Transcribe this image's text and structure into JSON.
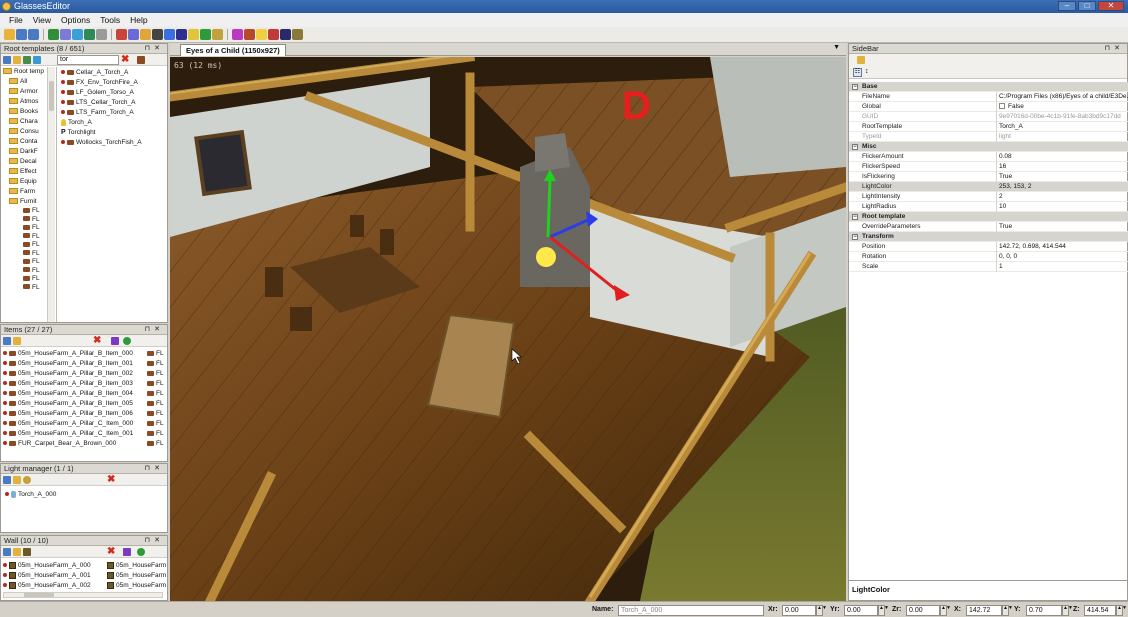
{
  "window": {
    "title": "GlassesEditor"
  },
  "menu": [
    "File",
    "View",
    "Options",
    "Tools",
    "Help"
  ],
  "toolbar_colors": [
    "#e8b33a",
    "#4a7ac2",
    "#4a7ac2",
    "#2f8f3a",
    "#7b7bd6",
    "#3aa0d8",
    "#2e8b57",
    "#9a9a9a",
    "#c9443a",
    "#6b6bd8",
    "#e2a53a",
    "#444",
    "#3a6ee2",
    "#2e2e8e",
    "#e2c43a",
    "#2e9a3a",
    "#c2a23a",
    "#ba3ac2",
    "#b84a2a",
    "#f0d040",
    "#c43a3a",
    "#2a2a6a",
    "#8a7a3a"
  ],
  "root_templates": {
    "title": "Root templates (8 / 651)",
    "filter": "tor",
    "tree": [
      "Root temp",
      "All",
      "Armor",
      "Atmos",
      "Books",
      "Chara",
      "Consu",
      "Conta",
      "DarkF",
      "Decal",
      "Effect",
      "Equip",
      "Farm",
      "Furnit"
    ],
    "tree_sub": [
      "FL",
      "FL",
      "FL",
      "FL",
      "FL",
      "FL",
      "FL",
      "FL",
      "FL",
      "FL"
    ],
    "results": [
      "Cellar_A_Torch_A",
      "FX_Env_TorchFire_A",
      "LF_Golem_Torso_A",
      "LTS_Cellar_Torch_A",
      "LTS_Farm_Torch_A",
      "Torch_A",
      "Torchlight",
      "Wollocks_TorchFish_A"
    ]
  },
  "items": {
    "title": "Items (27 / 27)",
    "list": [
      "05m_HouseFarm_A_Pillar_B_Item_000",
      "05m_HouseFarm_A_Pillar_B_Item_001",
      "05m_HouseFarm_A_Pillar_B_Item_002",
      "05m_HouseFarm_A_Pillar_B_Item_003",
      "05m_HouseFarm_A_Pillar_B_Item_004",
      "05m_HouseFarm_A_Pillar_B_Item_005",
      "05m_HouseFarm_A_Pillar_B_Item_006",
      "05m_HouseFarm_A_Pillar_C_Item_000",
      "05m_HouseFarm_A_Pillar_C_Item_001",
      "FUR_Carpet_Bear_A_Brown_000"
    ],
    "col2": [
      "FL",
      "FL",
      "FL",
      "FL",
      "FL",
      "FL",
      "FL",
      "FL",
      "FL",
      "FL"
    ]
  },
  "light_manager": {
    "title": "Light manager (1 / 1)",
    "list": [
      "Torch_A_000"
    ]
  },
  "wall": {
    "title": "Wall (10 / 10)",
    "col1": [
      "05m_HouseFarm_A_000",
      "05m_HouseFarm_A_001",
      "05m_HouseFarm_A_002"
    ],
    "col2": [
      "05m_HouseFarm",
      "05m_HouseFarm",
      "05m_HouseFarm"
    ]
  },
  "document": {
    "tab": "Eyes of a Child (1150x927)",
    "fps": "63 (12 ms)",
    "marker": "D"
  },
  "sidebar": {
    "title": "SideBar",
    "properties": [
      {
        "type": "cat",
        "k": "Base"
      },
      {
        "k": "FileName",
        "v": "C:/Program Files (x86)/Eyes of a child/E3De..."
      },
      {
        "k": "Global",
        "v": "False",
        "check": true
      },
      {
        "k": "GUID",
        "v": "9e97016d-00be-4c1b-91fe-8ab3bd9c17dd",
        "dim": true
      },
      {
        "k": "RootTemplate",
        "v": "Torch_A"
      },
      {
        "k": "TypeId",
        "v": "light",
        "dim": true
      },
      {
        "type": "cat",
        "k": "Misc"
      },
      {
        "k": "FlickerAmount",
        "v": "0.08"
      },
      {
        "k": "FlickerSpeed",
        "v": "16"
      },
      {
        "k": "IsFlickering",
        "v": "True"
      },
      {
        "k": "LightColor",
        "v": "253, 153, 2",
        "sel": true
      },
      {
        "k": "LightIntensity",
        "v": "2"
      },
      {
        "k": "LightRadius",
        "v": "10"
      },
      {
        "type": "cat",
        "k": "Root template"
      },
      {
        "k": "OverrideParameters",
        "v": "True"
      },
      {
        "type": "cat",
        "k": "Transform"
      },
      {
        "k": "Position",
        "v": "142.72, 0.698, 414.544"
      },
      {
        "k": "Rotation",
        "v": "0, 0, 0"
      },
      {
        "k": "Scale",
        "v": "1"
      }
    ],
    "description": "LightColor"
  },
  "status": {
    "name_label": "Name:",
    "name_value": "Torch_A_000",
    "xr_label": "Xr:",
    "xr": "0.00",
    "yr_label": "Yr:",
    "yr": "0.00",
    "zr_label": "Zr:",
    "zr": "0.00",
    "x_label": "X:",
    "x": "142.72",
    "y_label": "Y:",
    "y": "0.70",
    "z_label": "Z:",
    "z": "414.54"
  }
}
